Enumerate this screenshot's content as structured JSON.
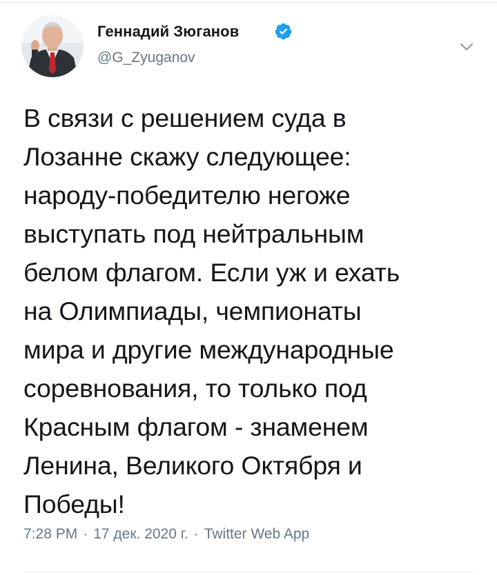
{
  "author": {
    "name": "Геннадий Зюганов",
    "handle": "@G_Zyuganov",
    "avatar_icon": "profile-photo",
    "verified_icon": "verified-badge-icon",
    "verified_color": "#1da1f2"
  },
  "menu": {
    "icon": "chevron-down-icon"
  },
  "tweet": {
    "text": "В связи с решением суда в\nЛозанне скажу следующее:\nнароду-победителю негоже\nвыступать под нейтральным\nбелом флагом. Если уж и ехать\nна Олимпиады, чемпионаты\nмира и другие международные\nсоревнования, то только под\nКрасным флагом - знаменем\nЛенина, Великого Октября и\nПобеды!"
  },
  "meta": {
    "time": "7:28 PM",
    "date": "17 дек. 2020 г.",
    "source": "Twitter Web App",
    "separator": "·"
  },
  "colors": {
    "text": "#14171a",
    "secondary": "#657786",
    "border": "#e6ecf0"
  }
}
